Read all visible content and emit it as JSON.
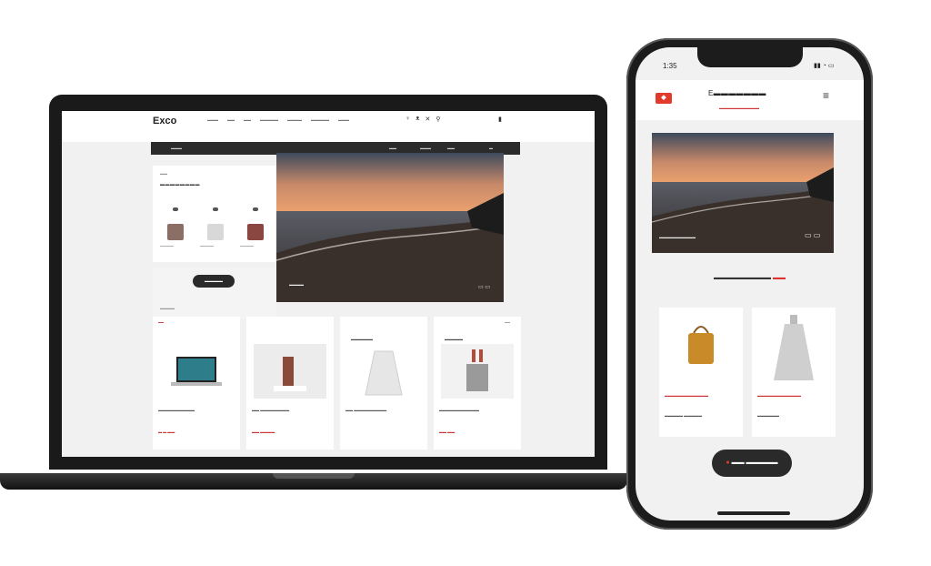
{
  "desktop": {
    "logo": "Exco",
    "nav": [
      "▬▬▬",
      "▬▬",
      "▬▬",
      "▬▬▬▬▬",
      "▬▬▬▬",
      "▬▬▬▬▬",
      "▬▬▬"
    ],
    "icons": [
      "♀",
      "ᴥ",
      "✕",
      "⚲"
    ],
    "cart": "▮",
    "bar": {
      "left": "▬▬▬",
      "items": [
        "▬▬",
        "▬▬▬",
        "▬▬",
        "▬"
      ]
    },
    "left_panel": {
      "small_label": "▬▬",
      "title": "▬▬▬▬▬▬▬▬",
      "thumbs": [
        {
          "caption": "▬▬▬▬▬",
          "color": "#8b6f66"
        },
        {
          "caption": "▬▬▬▬▬",
          "color": "#d8d8d8"
        },
        {
          "caption": "▬▬▬▬▬",
          "color": "#8a4640"
        }
      ],
      "pill": "▬▬▬▬▬",
      "footer": "▬▬▬▬"
    },
    "hero": {
      "caption": "▬▬▬▬",
      "icons": "▭ ▭"
    },
    "products": [
      {
        "tag": "▬▬",
        "label": "",
        "name": "▬▬▬▬▬▬▬▬▬▬",
        "price": "▬ ▬ ▬▬",
        "kind": "laptop"
      },
      {
        "tag": "",
        "label": "",
        "name": "▬▬ ▬▬▬▬▬▬▬▬",
        "price": "▬▬ ▬▬▬▬",
        "kind": "bottle"
      },
      {
        "tag": "",
        "label": "▬▬▬▬▬▬",
        "name": "▬▬ ▬▬▬▬▬▬▬▬▬",
        "price": "",
        "kind": "coat"
      },
      {
        "tag": "▬▬",
        "label": "▬▬▬▬▬",
        "name": "▬▬▬▬▬▬▬▬▬▬▬",
        "price": "▬▬ ▬▬",
        "kind": "set"
      }
    ]
  },
  "phone": {
    "time": "1:35",
    "status_icons": "▮▮ ◔ ▭",
    "logo": "◆",
    "title": "E▬▬▬▬▬▬▬",
    "subtitle": "▬▬▬▬▬▬▬▬▬▬▬",
    "menu": "≡",
    "hero": {
      "caption": "▬▬▬▬▬▬▬▬▬▬",
      "icons": "▭ ▭"
    },
    "section": {
      "text": "▬▬▬▬▬▬▬▬▬",
      "accent": "▬▬"
    },
    "products": [
      {
        "name": "▬▬▬▬▬▬▬▬▬▬▬▬",
        "price": "▬▬▬▬▬ ▬▬▬▬▬",
        "kind": "bag"
      },
      {
        "name": "▬▬▬▬▬▬▬▬▬▬▬▬",
        "price": "▬▬▬▬▬▬",
        "kind": "dress"
      }
    ],
    "cta": "▬▬ ▬▬▬▬▬"
  },
  "colors": {
    "accent": "#e23a2b",
    "dark": "#2a2a2a"
  }
}
